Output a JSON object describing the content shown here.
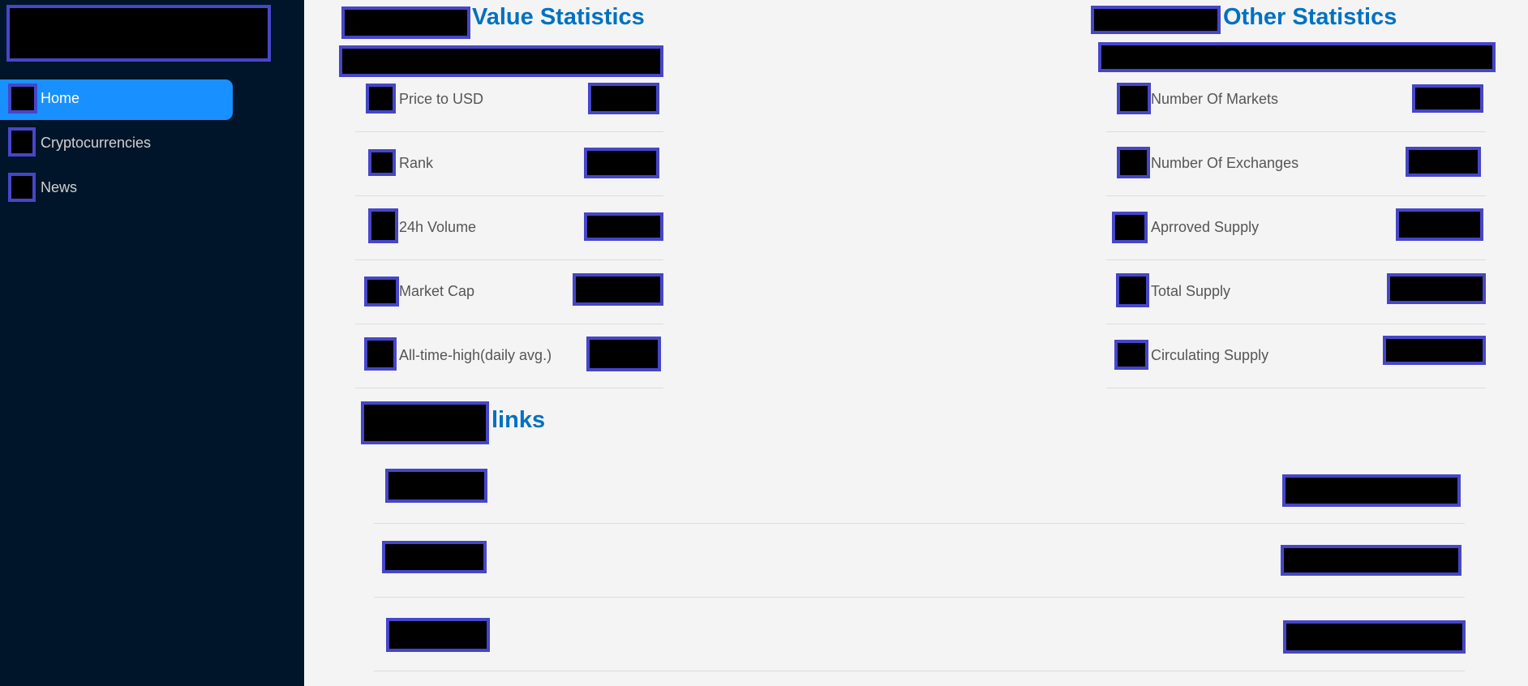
{
  "sidebar": {
    "nav": [
      {
        "label": "Home",
        "active": true,
        "icon": "home-icon"
      },
      {
        "label": "Cryptocurrencies",
        "active": false,
        "icon": "fund-icon"
      },
      {
        "label": "News",
        "active": false,
        "icon": "bulb-icon"
      }
    ]
  },
  "value_stats": {
    "title": "Value Statistics",
    "rows": [
      {
        "label": "Price to USD",
        "icon": "dollar-icon"
      },
      {
        "label": "Rank",
        "icon": "number-icon"
      },
      {
        "label": "24h Volume",
        "icon": "thunderbolt-icon"
      },
      {
        "label": "Market Cap",
        "icon": "dollar-icon"
      },
      {
        "label": "All-time-high(daily avg.)",
        "icon": "trophy-icon"
      }
    ]
  },
  "other_stats": {
    "title": "Other Statistics",
    "rows": [
      {
        "label": "Number Of Markets",
        "icon": "fund-icon"
      },
      {
        "label": "Number Of Exchanges",
        "icon": "money-collect-icon"
      },
      {
        "label": "Aprroved Supply",
        "icon": "check-icon"
      },
      {
        "label": "Total Supply",
        "icon": "exclamation-icon"
      },
      {
        "label": "Circulating Supply",
        "icon": "exclamation-icon"
      }
    ]
  },
  "links": {
    "title": "links"
  },
  "colors": {
    "sidebar_bg": "#001529",
    "active_nav": "#1890ff",
    "heading": "#0071c1",
    "main_bg": "#f4f4f4"
  }
}
